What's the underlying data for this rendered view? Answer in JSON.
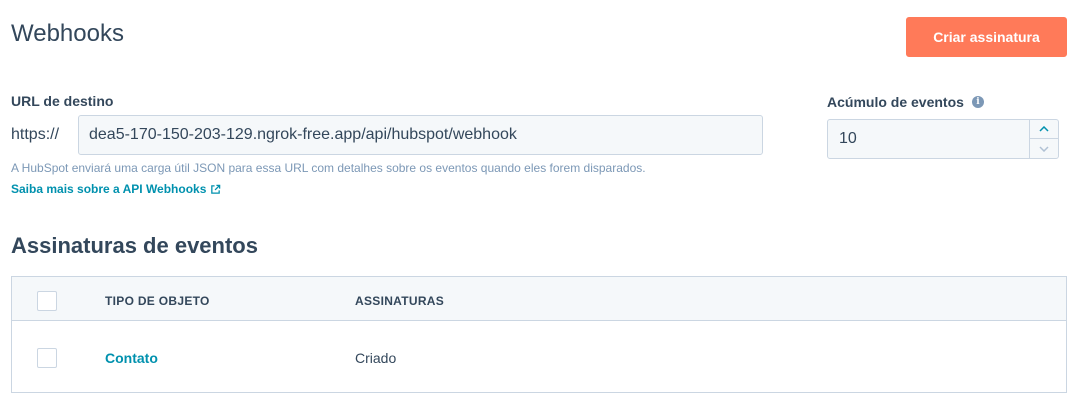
{
  "header": {
    "title": "Webhooks",
    "create_button": "Criar assinatura"
  },
  "target_url": {
    "label": "URL de destino",
    "prefix": "https://",
    "value": "dea5-170-150-203-129.ngrok-free.app/api/hubspot/webhook",
    "help_text": "A HubSpot enviará uma carga útil JSON para essa URL com detalhes sobre os eventos quando eles forem disparados.",
    "learn_more": "Saiba mais sobre a API Webhooks"
  },
  "batching": {
    "label": "Acúmulo de eventos",
    "value": "10"
  },
  "subscriptions": {
    "title": "Assinaturas de eventos",
    "columns": [
      "TIPO DE OBJETO",
      "ASSINATURAS"
    ],
    "rows": [
      {
        "object_type": "Contato",
        "subscriptions": "Criado"
      }
    ]
  },
  "colors": {
    "accent": "#ff7a59",
    "link": "#0091ae",
    "text": "#33475b"
  }
}
